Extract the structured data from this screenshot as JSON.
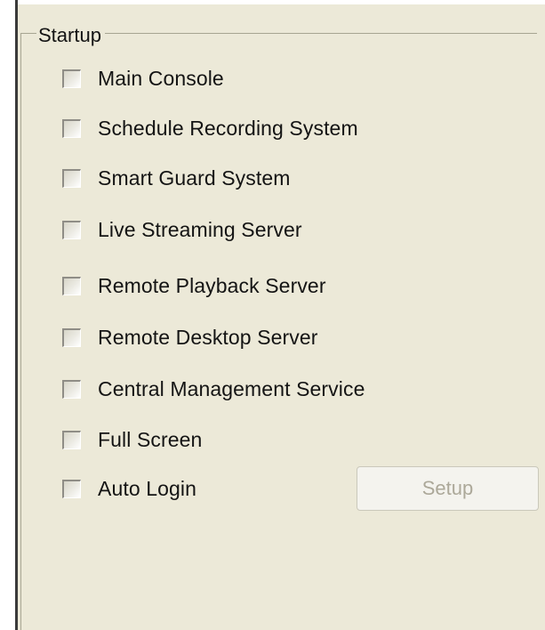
{
  "startup": {
    "title": "Startup",
    "options": [
      {
        "label": "Main Console",
        "checked": false
      },
      {
        "label": "Schedule Recording System",
        "checked": false
      },
      {
        "label": "Smart Guard System",
        "checked": false
      },
      {
        "label": "Live Streaming Server",
        "checked": false
      },
      {
        "label": "Remote Playback Server",
        "checked": false
      },
      {
        "label": "Remote Desktop Server",
        "checked": false
      },
      {
        "label": "Central Management Service",
        "checked": false
      },
      {
        "label": "Full Screen",
        "checked": false
      },
      {
        "label": "Auto Login",
        "checked": false
      }
    ],
    "setup_label": "Setup",
    "setup_enabled": false
  },
  "colors": {
    "panel": "#ece9d8",
    "groupbox_border": "#a7a592",
    "disabled_text": "#aca899"
  }
}
